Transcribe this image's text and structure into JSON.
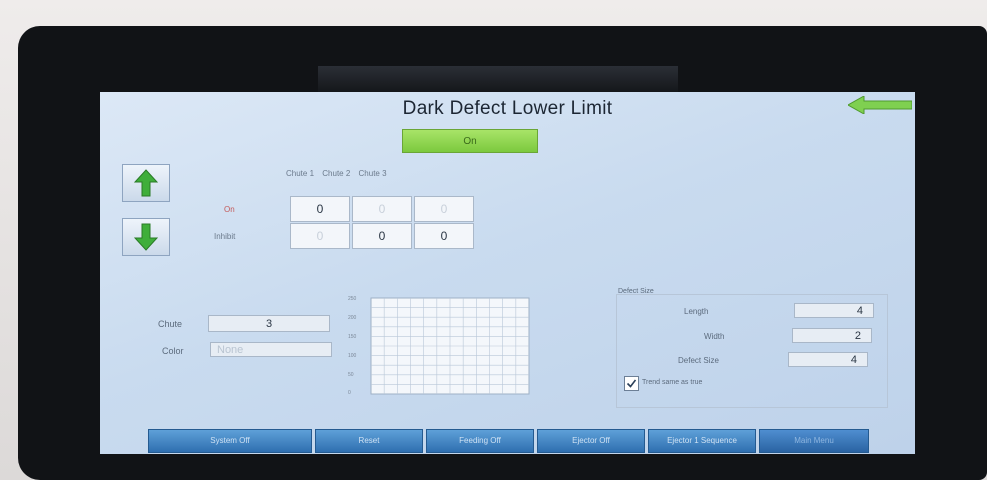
{
  "screen": {
    "title": "Dark Defect Lower Limit",
    "toggle_label": "On"
  },
  "chute_grid": {
    "headers": [
      "Chute 1",
      "Chute 2",
      "Chute 3"
    ],
    "rows": [
      {
        "label": "On",
        "values": [
          "0",
          "0",
          "0"
        ],
        "active": [
          true,
          false,
          false
        ]
      },
      {
        "label": "Inhibit",
        "values": [
          "0",
          "0",
          "0"
        ],
        "active": [
          false,
          true,
          true
        ]
      }
    ]
  },
  "chute_select": {
    "chute_label": "Chute",
    "chute_value": "3",
    "color_label": "Color",
    "color_value": "None"
  },
  "chart_data": {
    "type": "heatmap",
    "title": "",
    "yticks": [
      "250",
      "200",
      "150",
      "100",
      "50",
      "0"
    ],
    "ylim": [
      0,
      250
    ],
    "grid": true
  },
  "defect_size": {
    "title": "Defect Size",
    "length_label": "Length",
    "length_value": "4",
    "width_label": "Width",
    "width_value": "2",
    "size_label": "Defect Size",
    "size_value": "4",
    "checkbox_label": "Trend same as true",
    "checkbox_checked": true
  },
  "bottom_bar": {
    "items": [
      "System Off",
      "Reset",
      "Feeding Off",
      "Ejector Off",
      "Ejector 1 Sequence",
      "Main Menu"
    ]
  },
  "colors": {
    "screen_bg": "#c9dbef",
    "on_green": "#8fd24e",
    "bottom_blue": "#3d7fc0",
    "arrow_green": "#3fae3a"
  }
}
